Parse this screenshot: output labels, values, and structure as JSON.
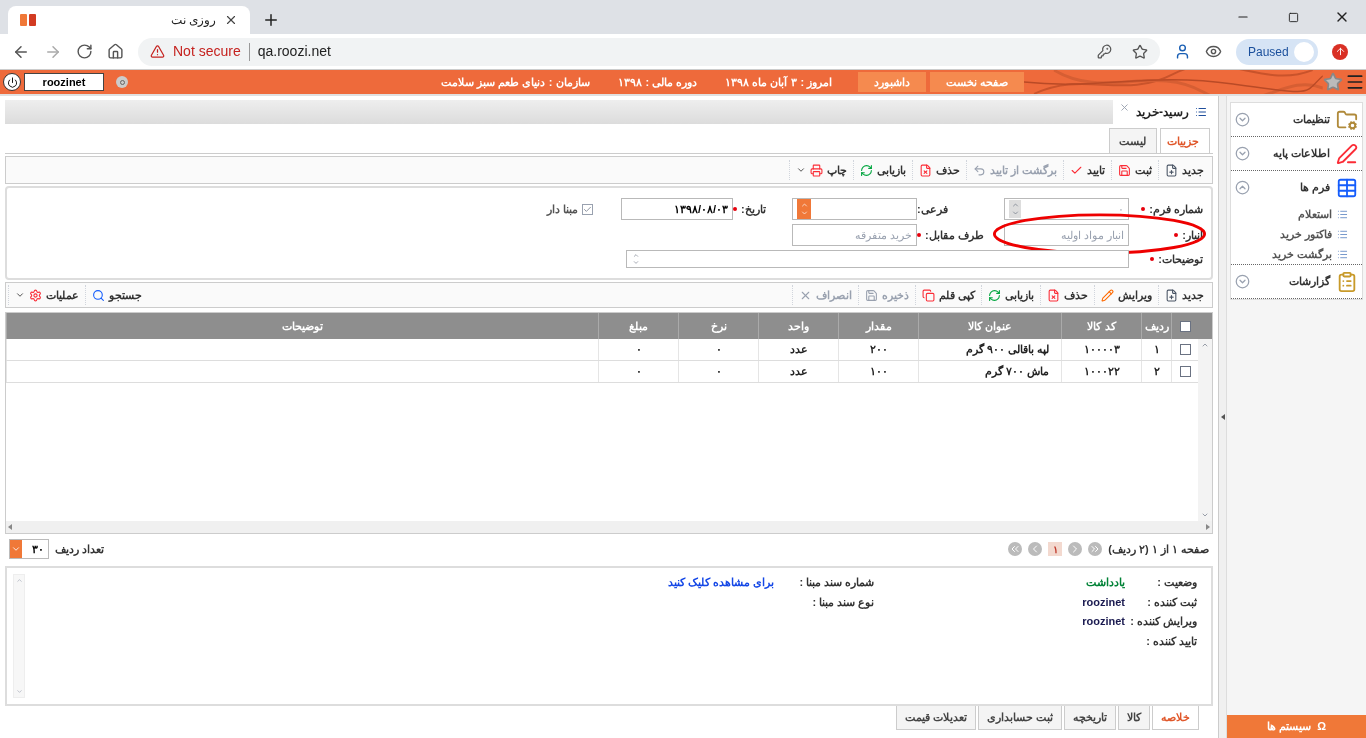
{
  "browser": {
    "tab_title": "روزی نت",
    "security_label": "Not secure",
    "url": "qa.roozi.net",
    "profile_label": "Paused"
  },
  "topbar": {
    "user": "roozinet",
    "buttons": [
      "صفحه نخست",
      "داشبورد"
    ],
    "info": [
      {
        "label": "امروز :",
        "value": "۳ آبان ماه ۱۳۹۸"
      },
      {
        "label": "دوره مالی :",
        "value": "۱۳۹۸"
      },
      {
        "label": "سازمان :",
        "value": "دنیای طعم سبز سلامت"
      }
    ]
  },
  "document_tab": {
    "title": "رسید-خرید"
  },
  "view_tabs": [
    {
      "label": "جزییات",
      "selected": true
    },
    {
      "label": "لیست",
      "selected": false
    }
  ],
  "toolbar": [
    {
      "label": "جدید",
      "kind": "new",
      "disabled": false,
      "dropdown": false
    },
    {
      "label": "ثبت",
      "kind": "save",
      "disabled": false,
      "dropdown": false
    },
    {
      "label": "تایید",
      "kind": "approve",
      "disabled": false,
      "dropdown": false
    },
    {
      "label": "برگشت از تایید",
      "kind": "unapprove",
      "disabled": true,
      "dropdown": false
    },
    {
      "label": "حذف",
      "kind": "delete",
      "disabled": false,
      "dropdown": false
    },
    {
      "label": "بازیابی",
      "kind": "restore",
      "disabled": false,
      "dropdown": false
    },
    {
      "label": "چاپ",
      "kind": "print",
      "disabled": false,
      "dropdown": true
    }
  ],
  "form": {
    "rows": [
      [
        {
          "label": "شماره فرم:",
          "required": true,
          "kind": "spinner",
          "value": "۰",
          "disabled": true,
          "highlighted": false
        },
        {
          "label": "فرعی:",
          "required": false,
          "kind": "select",
          "highlighted": false
        },
        {
          "label": "تاریخ:",
          "required": true,
          "kind": "text",
          "value": "۱۳۹۸/۰۸/۰۳",
          "disabled": false,
          "highlighted": false
        },
        {
          "label": "مبنا دار",
          "kind": "checkbox",
          "checked": true
        }
      ],
      [
        {
          "label": "انبار:",
          "required": true,
          "kind": "text",
          "value": "انبار مواد اولیه",
          "disabled": true,
          "highlighted": true
        },
        {
          "label": "طرف مقابل:",
          "required": true,
          "kind": "text",
          "value": "خرید متفرقه",
          "disabled": true,
          "highlighted": false
        }
      ],
      [
        {
          "label": "توضیحات:",
          "required": true,
          "kind": "textarea",
          "highlighted": false
        }
      ]
    ]
  },
  "grid_toolbar": [
    {
      "label": "جدید",
      "kind": "new",
      "disabled": false,
      "dropdown": false
    },
    {
      "label": "ویرایش",
      "kind": "edit",
      "disabled": false,
      "dropdown": false
    },
    {
      "label": "حذف",
      "kind": "delete",
      "disabled": false,
      "dropdown": false
    },
    {
      "label": "بازیابی",
      "kind": "restore",
      "disabled": false,
      "dropdown": false
    },
    {
      "label": "کپی قلم",
      "kind": "copy",
      "disabled": false,
      "dropdown": false
    },
    {
      "label": "ذخیره",
      "kind": "save",
      "disabled": true,
      "dropdown": false
    },
    {
      "label": "انصراف",
      "kind": "cancel",
      "disabled": true,
      "dropdown": false
    }
  ],
  "grid_tools": [
    {
      "label": "جستجو",
      "kind": "search",
      "disabled": false,
      "dropdown": false
    },
    {
      "label": "عملیات",
      "kind": "operations",
      "disabled": false,
      "dropdown": true
    }
  ],
  "table": {
    "select_all_checked": false,
    "columns": [
      "ردیف",
      "کد کالا",
      "عنوان کالا",
      "مقدار",
      "واحد",
      "نرخ",
      "مبلغ",
      "توضیحات"
    ],
    "rows": [
      {
        "checked": false,
        "cells": [
          "۱",
          "۱۰۰۰۰۳",
          "لپه باقالی ۹۰۰ گرم",
          "۲۰۰",
          "عدد",
          "۰",
          "۰"
        ]
      },
      {
        "checked": false,
        "cells": [
          "۲",
          "۱۰۰۰۲۲",
          "ماش ۷۰۰ گرم",
          "۱۰۰",
          "عدد",
          "۰",
          "۰"
        ]
      }
    ]
  },
  "pager": {
    "summary": "صفحه ۱ از ۱ (۲ ردیف)",
    "page": "۱",
    "page_size_label": "تعداد ردیف",
    "page_size": "۳۰"
  },
  "summary": {
    "left": [
      {
        "label": "وضعیت :",
        "value": "یادداشت",
        "kind": "status"
      },
      {
        "label": "ثبت کننده :",
        "value": "roozinet",
        "kind": "user"
      },
      {
        "label": "ویرایش کننده :",
        "value": "roozinet",
        "kind": "user"
      },
      {
        "label": "تایید کننده :"
      }
    ],
    "right": [
      {
        "label": "شماره سند مبنا :",
        "value": "برای مشاهده کلیک کنید",
        "kind": "link"
      },
      {
        "label": "نوع سند مبنا :"
      }
    ]
  },
  "bottom_tabs": [
    {
      "label": "خلاصه",
      "selected": true
    },
    {
      "label": "کالا",
      "selected": false
    },
    {
      "label": "تاریخچه",
      "selected": false
    },
    {
      "label": "ثبت حسابداری",
      "selected": false
    },
    {
      "label": "تعدیلات قیمت",
      "selected": false
    }
  ],
  "sidebar": {
    "groups": [
      {
        "label": "تنظیمات",
        "kind": "settings",
        "expanded": false
      },
      {
        "label": "اطلاعات پایه",
        "kind": "base",
        "expanded": false
      },
      {
        "label": "فرم ها",
        "kind": "forms",
        "expanded": true,
        "children": [
          "استعلام",
          "فاکتور خرید",
          "برگشت خرید"
        ]
      },
      {
        "label": "گزارشات",
        "kind": "reports",
        "expanded": false
      }
    ],
    "footer_icon": "Ω",
    "footer": "سیستم ها"
  }
}
